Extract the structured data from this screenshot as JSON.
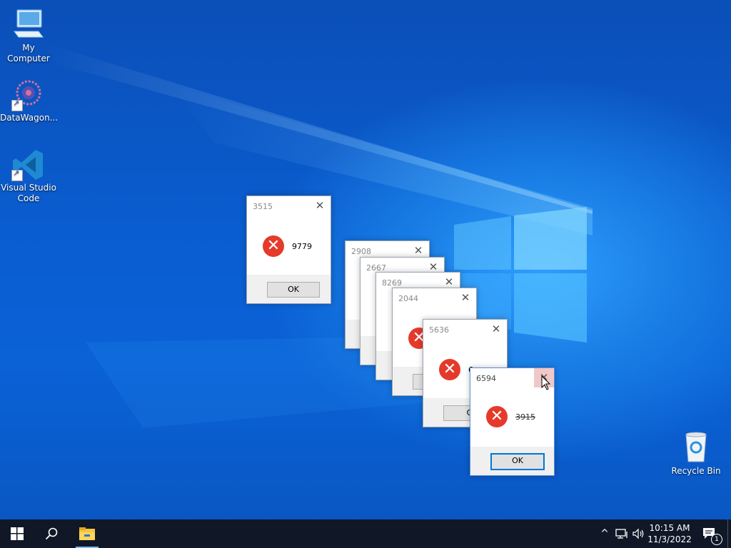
{
  "desktop": {
    "icons": [
      {
        "label": "My Computer"
      },
      {
        "label": "DataWagon..."
      },
      {
        "label": "Visual Studio Code"
      },
      {
        "label": "Recycle Bin"
      }
    ]
  },
  "dialogs": [
    {
      "title": "3515",
      "message": "9779",
      "ok_label": "OK"
    },
    {
      "title": "2908",
      "message": "",
      "ok_label": ""
    },
    {
      "title": "2667",
      "message": "",
      "ok_label": ""
    },
    {
      "title": "8269",
      "message": "",
      "ok_label": ""
    },
    {
      "title": "2044",
      "message": "",
      "ok_label": ""
    },
    {
      "title": "5636",
      "message": "6",
      "ok_label": "O"
    },
    {
      "title": "6594",
      "message": "3915",
      "ok_label": "OK"
    }
  ],
  "dialog_close_glyph": "✕",
  "error_glyph": "✕",
  "taskbar": {
    "start_icon": "windows-start-icon",
    "search_icon": "search-icon",
    "explorer_icon": "file-explorer-icon",
    "tray": {
      "chevron": "^",
      "time": "10:15 AM",
      "date": "11/3/2022",
      "notification_count": "1"
    }
  },
  "colors": {
    "accent": "#0078d7",
    "error": "#e53a2a",
    "taskbar": "#101828"
  }
}
